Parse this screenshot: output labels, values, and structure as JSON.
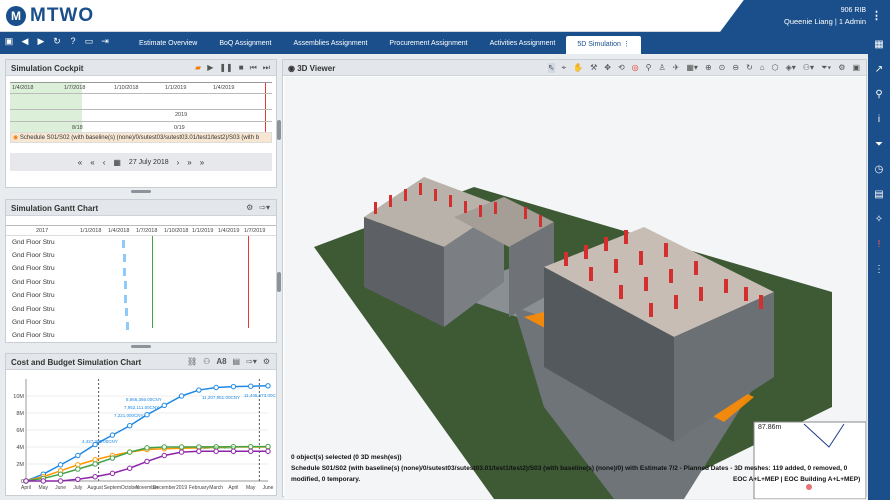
{
  "brand": {
    "logo_mark": "M",
    "logo_text": "MTWO"
  },
  "user": {
    "company": "906 RIB",
    "name": "Queenie Liang | 1 Admin"
  },
  "nav_icons": [
    "save-icon",
    "back-icon",
    "forward-icon",
    "refresh-icon",
    "help-icon",
    "monitor-icon",
    "export-icon"
  ],
  "tabs": [
    "Estimate Overview",
    "BoQ Assignment",
    "Assemblies Assignment",
    "Procurement Assignment",
    "Activities Assignment",
    "5D Simulation"
  ],
  "cockpit": {
    "title": "Simulation Cockpit",
    "dates_top": [
      "1/4/2018",
      "1/7/2018",
      "1/10/2018",
      "1/1/2019",
      "1/4/2019"
    ],
    "year_label": "2019",
    "bottom_labels": [
      "8/18",
      "0/19"
    ],
    "schedule_text": "Schedule S01/S02 (with baseline(s) (none)/0/sutest03/sutest03.01/test1/test2)/S03 (with b",
    "current_date": "27 July 2018"
  },
  "gantt": {
    "title": "Simulation Gantt Chart",
    "dates": [
      "2017",
      "1/1/2018",
      "1/4/2018",
      "1/7/2018",
      "1/10/2018",
      "1/1/2019",
      "1/4/2019",
      "1/7/2019"
    ],
    "rows": [
      "Gnd Floor Stru",
      "Gnd Floor Stru",
      "Gnd Floor Stru",
      "Gnd Floor Stru",
      "Gnd Floor Stru",
      "Gnd Floor Stru",
      "Gnd Floor Stru",
      "Gnd Floor Stru"
    ]
  },
  "cost_chart": {
    "title": "Cost and Budget Simulation Chart",
    "toolbar_label": "A8"
  },
  "chart_data": {
    "type": "line",
    "title": "",
    "xlabel": "",
    "ylabel": "",
    "categories": [
      "April",
      "May",
      "June",
      "July",
      "August",
      "September",
      "October",
      "November",
      "December",
      "2019",
      "February",
      "March",
      "April",
      "May",
      "June"
    ],
    "tick_x": [
      "April",
      "May",
      "June",
      "July",
      "August",
      "Septem",
      "October",
      "November",
      "December",
      "2019",
      "February",
      "March",
      "April",
      "May",
      "June"
    ],
    "y_ticks": [
      "0",
      "2M",
      "4M",
      "6M",
      "8M",
      "10M"
    ],
    "ylim": [
      0,
      12000000
    ],
    "series": [
      {
        "color": "#1e88e5",
        "values": [
          0,
          800000,
          1900000,
          3000000,
          4300000,
          5400000,
          6500000,
          7800000,
          8900000,
          10000000,
          10700000,
          11000000,
          11100000,
          11150000,
          11200000
        ]
      },
      {
        "color": "#ff9800",
        "values": [
          0,
          500000,
          1200000,
          1900000,
          2500000,
          3000000,
          3400000,
          3700000,
          3800000,
          3850000,
          3900000,
          3950000,
          4000000,
          4000000,
          4000000
        ]
      },
      {
        "color": "#43a047",
        "values": [
          0,
          300000,
          800000,
          1400000,
          2000000,
          2700000,
          3400000,
          3900000,
          4000000,
          4000000,
          4010000,
          4020000,
          4030000,
          4040000,
          4050000
        ]
      },
      {
        "color": "#8e24aa",
        "values": [
          0,
          0,
          0,
          200000,
          500000,
          900000,
          1500000,
          2300000,
          3000000,
          3400000,
          3500000,
          3500000,
          3500000,
          3500000,
          3500000
        ]
      }
    ],
    "data_labels": [
      "11,207,951.00CNY",
      "11,445,673.00CNY",
      "4,007,764.00CNY",
      "8,866,356.00CNY",
      "7,952,111.00CNY",
      "7,221,000CNY",
      "4,427,300.00CNY"
    ]
  },
  "viewer": {
    "title": "3D Viewer",
    "selected_text": "0 object(s) selected (0 3D mesh(es))",
    "schedule_text": "Schedule S01/S02 (with baseline(s) (none)/0/sutest03/sutest03.01/test1/test2)/S03 (with baseline(s) (none)/0) with Estimate 7/2 - Planned Dates - 3D meshes: 119 added, 0 removed, 0",
    "modified_text": "modified, 0 temporary.",
    "minimap_label": "87.86m",
    "model_label": "EOC A+L+MEP | EOC Building A+L+MEP)"
  },
  "colors": {
    "brand": "#1a4f8b",
    "accent_orange": "#f57c00"
  }
}
